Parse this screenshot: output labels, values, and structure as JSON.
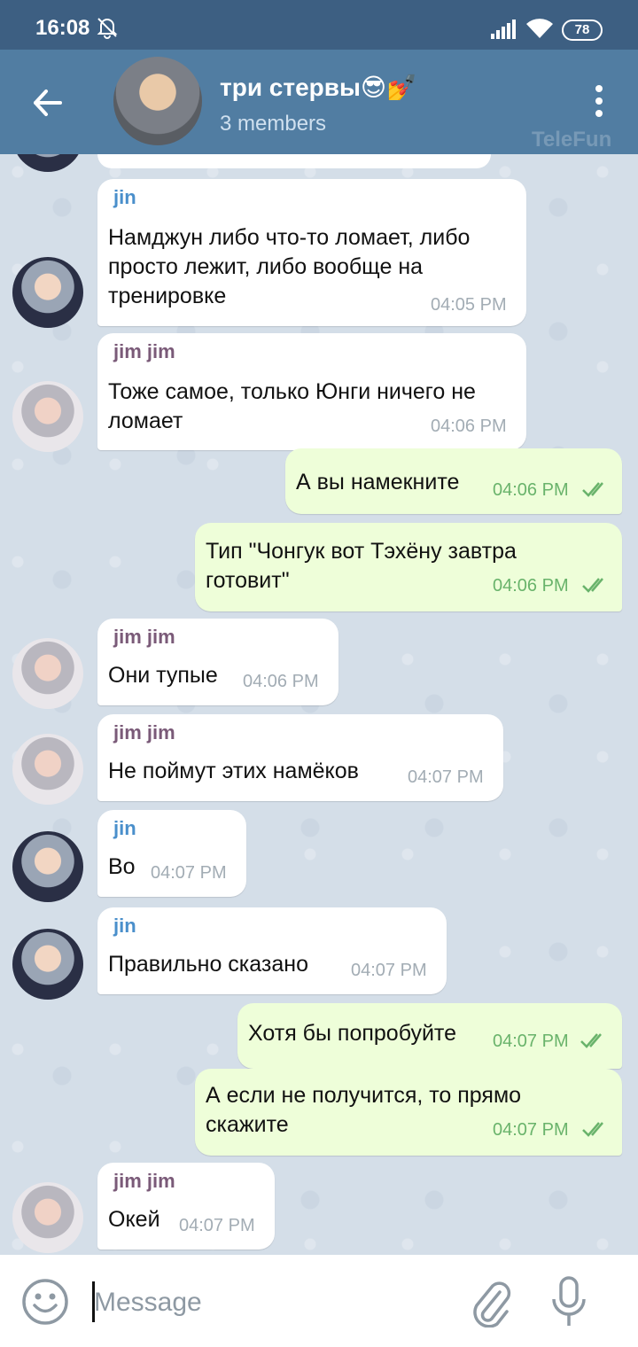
{
  "status_bar": {
    "time": "16:08",
    "battery": "78"
  },
  "header": {
    "title": "три стервы😎💅",
    "subtitle": "3 members",
    "watermark": "TeleFun"
  },
  "messages": [
    {
      "sender": "jin",
      "text": "Намджун либо что-то ломает, либо просто лежит, либо вообще на тренировке",
      "time": "04:05 PM"
    },
    {
      "sender": "jim jim",
      "text": "Тоже самое, только Юнги ничего не ломает",
      "time": "04:06 PM"
    },
    {
      "text": "А вы намекните",
      "time": "04:06 PM"
    },
    {
      "text": "Тип \"Чонгук вот Тэхёну завтра готовит\"",
      "time": "04:06 PM"
    },
    {
      "sender": "jim jim",
      "text": "Они тупые",
      "time": "04:06 PM"
    },
    {
      "sender": "jim jim",
      "text": "Не поймут этих намёков",
      "time": "04:07 PM"
    },
    {
      "sender": "jin",
      "text": "Во",
      "time": "04:07 PM"
    },
    {
      "sender": "jin",
      "text": "Правильно сказано",
      "time": "04:07 PM"
    },
    {
      "text": "Хотя бы попробуйте",
      "time": "04:07 PM"
    },
    {
      "text": "А если не получится, то прямо скажите",
      "time": "04:07 PM"
    },
    {
      "sender": "jim jim",
      "text": "Окей",
      "time": "04:07 PM"
    }
  ],
  "composer": {
    "placeholder": "Message"
  },
  "icons": {
    "back": "arrow-left-icon",
    "menu": "more-vertical-icon",
    "emoji": "emoji-icon",
    "attach": "paperclip-icon",
    "mic": "microphone-icon",
    "read": "double-check-icon"
  },
  "colors": {
    "header": "#517da2",
    "status_bar": "#3d5f82",
    "incoming_bubble": "#ffffff",
    "outgoing_bubble": "#eefed9",
    "read_checks": "#69b36b",
    "sender_jin": "#4a8fcb",
    "sender_jimjim": "#7a5a78"
  }
}
